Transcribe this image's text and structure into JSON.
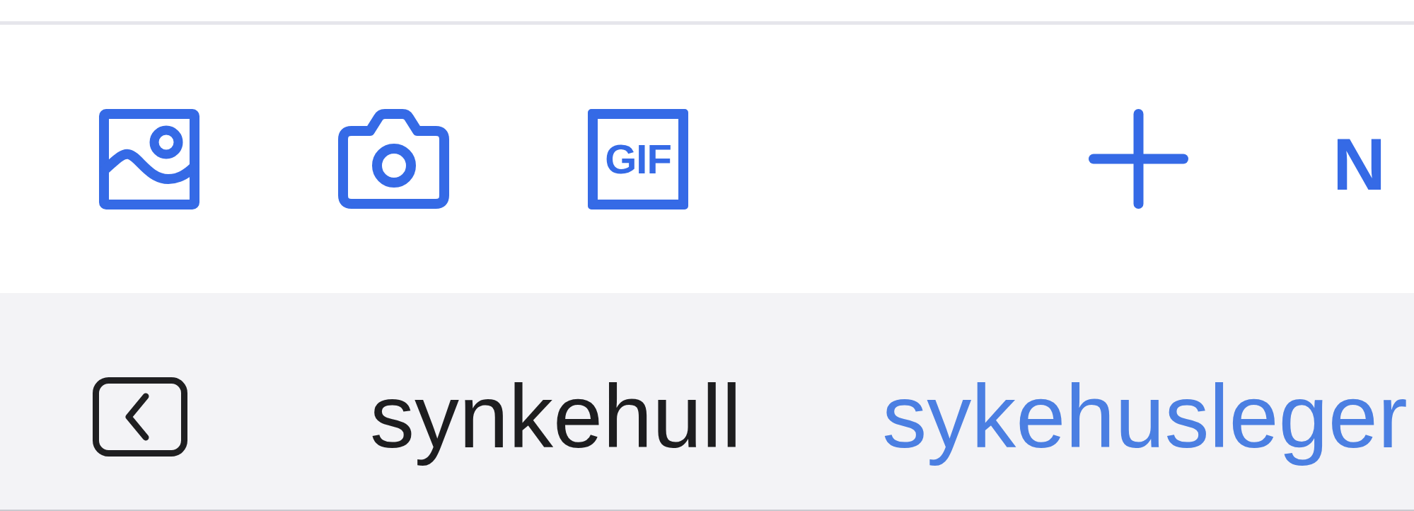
{
  "toolbar": {
    "buttons": [
      {
        "kind": "image"
      },
      {
        "kind": "camera"
      },
      {
        "kind": "gif",
        "label": "GIF"
      },
      {
        "kind": "add"
      }
    ],
    "action": {
      "label": "N"
    }
  },
  "suggestion_bar": {
    "words": [
      {
        "text": "synkehull",
        "selected": false
      },
      {
        "text": "sykehusleger",
        "selected": true
      }
    ]
  }
}
